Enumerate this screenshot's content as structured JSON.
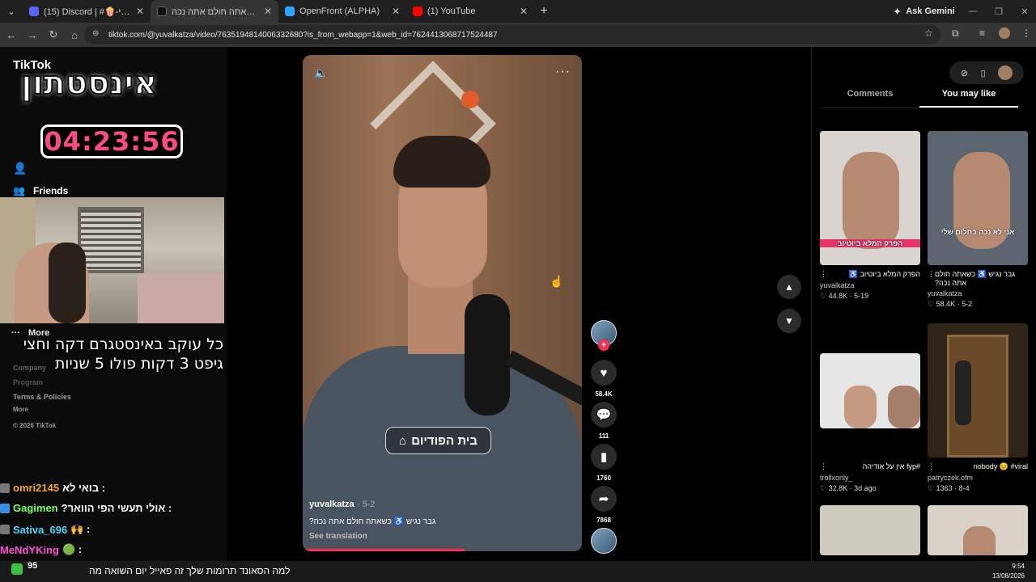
{
  "browser": {
    "tabs": [
      {
        "label": "(15) Discord | #🍿-ראשי-🍿",
        "color": "#5865f2"
      },
      {
        "label": "גבר נגיש ♿ כשאתה חולם אתה נכה",
        "color": "#111111"
      },
      {
        "label": "OpenFront (ALPHA)",
        "color": "#2aa4ff"
      },
      {
        "label": "(1) YouTube",
        "color": "#ff0000"
      }
    ],
    "ask_gemini": "Ask Gemini",
    "url": "tiktok.com/@yuvalkatza/video/7635194814006332680?is_from_webapp=1&web_id=7624413068717524487"
  },
  "sidebar": {
    "logo": "TikTok",
    "friends_label": "Friends",
    "more_label": "More",
    "banner_title": "אינסטתון",
    "timer": "04:23:56",
    "overlay_text": "כל עוקב באינסטגרם דקה וחצי גיפט 3 דקות פולו 5 שניות",
    "footer": [
      "Company",
      "Program",
      "Terms & Policies",
      "More",
      "© 2026 TikTok"
    ]
  },
  "chat": [
    {
      "user": "omri2145",
      "msg": ": בואי לא",
      "color": "#f5a623"
    },
    {
      "user": "Gagimen",
      "msg": ": אולי תעשי הפי הוואר?",
      "color": "#7cff5a"
    },
    {
      "user": "Sativa_696",
      "msg": ": 🙌",
      "color": "#4ad7ff"
    },
    {
      "user": "MeNdYKing",
      "msg": ": 🟢",
      "color": "#ff4fd8"
    }
  ],
  "video": {
    "caption": "בית הפודיום",
    "author": "yuvalkatza",
    "date": "· 5-2",
    "description": "גבר נגיש ♿ כשאתה חולם אתה נכה?",
    "see_translation": "See translation",
    "progress": 0.58
  },
  "actions": {
    "likes": "58.4K",
    "comments": "111",
    "saves": "1760",
    "shares": "7868"
  },
  "right_panel": {
    "tabs": [
      "Comments",
      "You may like"
    ],
    "selected_tab": "You may like",
    "cards": [
      {
        "thumb_caption": "הפרק המלא ביוטיוב",
        "title": "הפרק המלא ביוטיוב ♿",
        "author": "yuvalkatza",
        "likes": "44.8K",
        "date": "5-19",
        "bg": "#d9d4cf"
      },
      {
        "thumb_caption": "אני לא נכה בחלום שלי",
        "title": "גבר נגיש ♿ כשאתה חולם אתה נכה?",
        "author": "yuvalkatza",
        "likes": "58.4K",
        "date": "5-2",
        "bg": "#5d6670"
      },
      {
        "thumb_caption": "",
        "title": "#fyp אין על אודיהה",
        "author": "trollxonly_",
        "likes": "32.8K",
        "date": "3d ago",
        "bg": "#e6e6e6"
      },
      {
        "thumb_caption": "",
        "title": "nobody 😊 #viral",
        "author": "patryczek.ofm",
        "likes": "1363",
        "date": "8-4",
        "bg": "#2e2418"
      }
    ]
  },
  "taskbar": {
    "ticker": "למה הסאונד תרומות שלך זה פאייל יום השואה מה",
    "count": "95",
    "time": "9:54",
    "date": "13/08/2026"
  }
}
